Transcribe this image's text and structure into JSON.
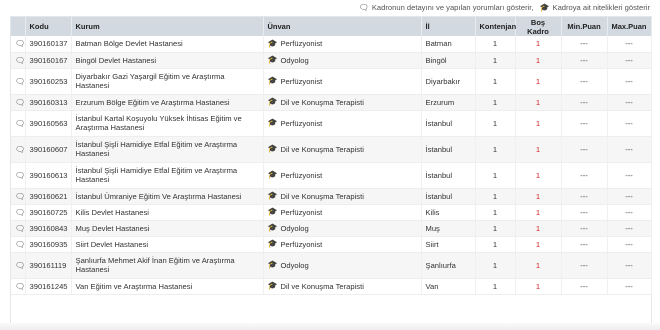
{
  "links": {
    "detay_label": "Kadronun detayını ve yapılan yorumları gösterir,",
    "nitelik_label": "Kadroya ait nitelikleri gösterir"
  },
  "columns": {
    "kodu": "Kodu",
    "kurum": "Kurum",
    "unvan": "Ünvan",
    "il": "İl",
    "kontenjan": "Kontenjan",
    "bos_kadro": "Boş Kadro",
    "min_puan": "Min.Puan",
    "max_puan": "Max.Puan"
  },
  "rows": [
    {
      "kodu": "390160137",
      "kurum": "Batman Bölge Devlet Hastanesi",
      "unvan": "Perfüzyonist",
      "il": "Batman",
      "kontenjan": "1",
      "bos": "1",
      "min": "---",
      "max": "---"
    },
    {
      "kodu": "390160167",
      "kurum": "Bingöl Devlet Hastanesi",
      "unvan": "Odyolog",
      "il": "Bingöl",
      "kontenjan": "1",
      "bos": "1",
      "min": "---",
      "max": "---"
    },
    {
      "kodu": "390160253",
      "kurum": "Diyarbakır Gazi Yaşargil Eğitim ve Araştırma Hastanesi",
      "unvan": "Perfüzyonist",
      "il": "Diyarbakır",
      "kontenjan": "1",
      "bos": "1",
      "min": "---",
      "max": "---"
    },
    {
      "kodu": "390160313",
      "kurum": "Erzurum Bölge Eğitim ve Araştırma Hastanesi",
      "unvan": "Dil ve Konuşma Terapisti",
      "il": "Erzurum",
      "kontenjan": "1",
      "bos": "1",
      "min": "---",
      "max": "---"
    },
    {
      "kodu": "390160563",
      "kurum": "İstanbul Kartal Koşuyolu Yüksek İhtisas Eğitim ve Araştırma Hastanesi",
      "unvan": "Perfüzyonist",
      "il": "İstanbul",
      "kontenjan": "1",
      "bos": "1",
      "min": "---",
      "max": "---"
    },
    {
      "kodu": "390160607",
      "kurum": "İstanbul Şişli Hamidiye Etfal Eğitim ve Araştırma Hastanesi",
      "unvan": "Dil ve Konuşma Terapisti",
      "il": "İstanbul",
      "kontenjan": "1",
      "bos": "1",
      "min": "---",
      "max": "---"
    },
    {
      "kodu": "390160613",
      "kurum": "İstanbul Şişli Hamidiye Etfal Eğitim ve Araştırma Hastanesi",
      "unvan": "Perfüzyonist",
      "il": "İstanbul",
      "kontenjan": "1",
      "bos": "1",
      "min": "---",
      "max": "---"
    },
    {
      "kodu": "390160621",
      "kurum": "İstanbul Ümraniye Eğitim Ve Araştırma Hastanesi",
      "unvan": "Dil ve Konuşma Terapisti",
      "il": "İstanbul",
      "kontenjan": "1",
      "bos": "1",
      "min": "---",
      "max": "---"
    },
    {
      "kodu": "390160725",
      "kurum": "Kilis Devlet Hastanesi",
      "unvan": "Perfüzyonist",
      "il": "Kilis",
      "kontenjan": "1",
      "bos": "1",
      "min": "---",
      "max": "---"
    },
    {
      "kodu": "390160843",
      "kurum": "Muş Devlet Hastanesi",
      "unvan": "Odyolog",
      "il": "Muş",
      "kontenjan": "1",
      "bos": "1",
      "min": "---",
      "max": "---"
    },
    {
      "kodu": "390160935",
      "kurum": "Siirt Devlet Hastanesi",
      "unvan": "Perfüzyonist",
      "il": "Siirt",
      "kontenjan": "1",
      "bos": "1",
      "min": "---",
      "max": "---"
    },
    {
      "kodu": "390161119",
      "kurum": "Şanlıurfa Mehmet Akif İnan Eğitim ve Araştırma Hastanesi",
      "unvan": "Odyolog",
      "il": "Şanlıurfa",
      "kontenjan": "1",
      "bos": "1",
      "min": "---",
      "max": "---"
    },
    {
      "kodu": "390161245",
      "kurum": "Van Eğitim ve Araştırma Hastanesi",
      "unvan": "Dil ve Konuşma Terapisti",
      "il": "Van",
      "kontenjan": "1",
      "bos": "1",
      "min": "---",
      "max": "---"
    }
  ],
  "icons": {
    "comment": "comments-icon",
    "cap": "graduation-cap-icon"
  },
  "colors": {
    "header_bg": "#d2d9e1",
    "bos_kadro": "#d02020",
    "row_alt": "#f6f6f6"
  }
}
